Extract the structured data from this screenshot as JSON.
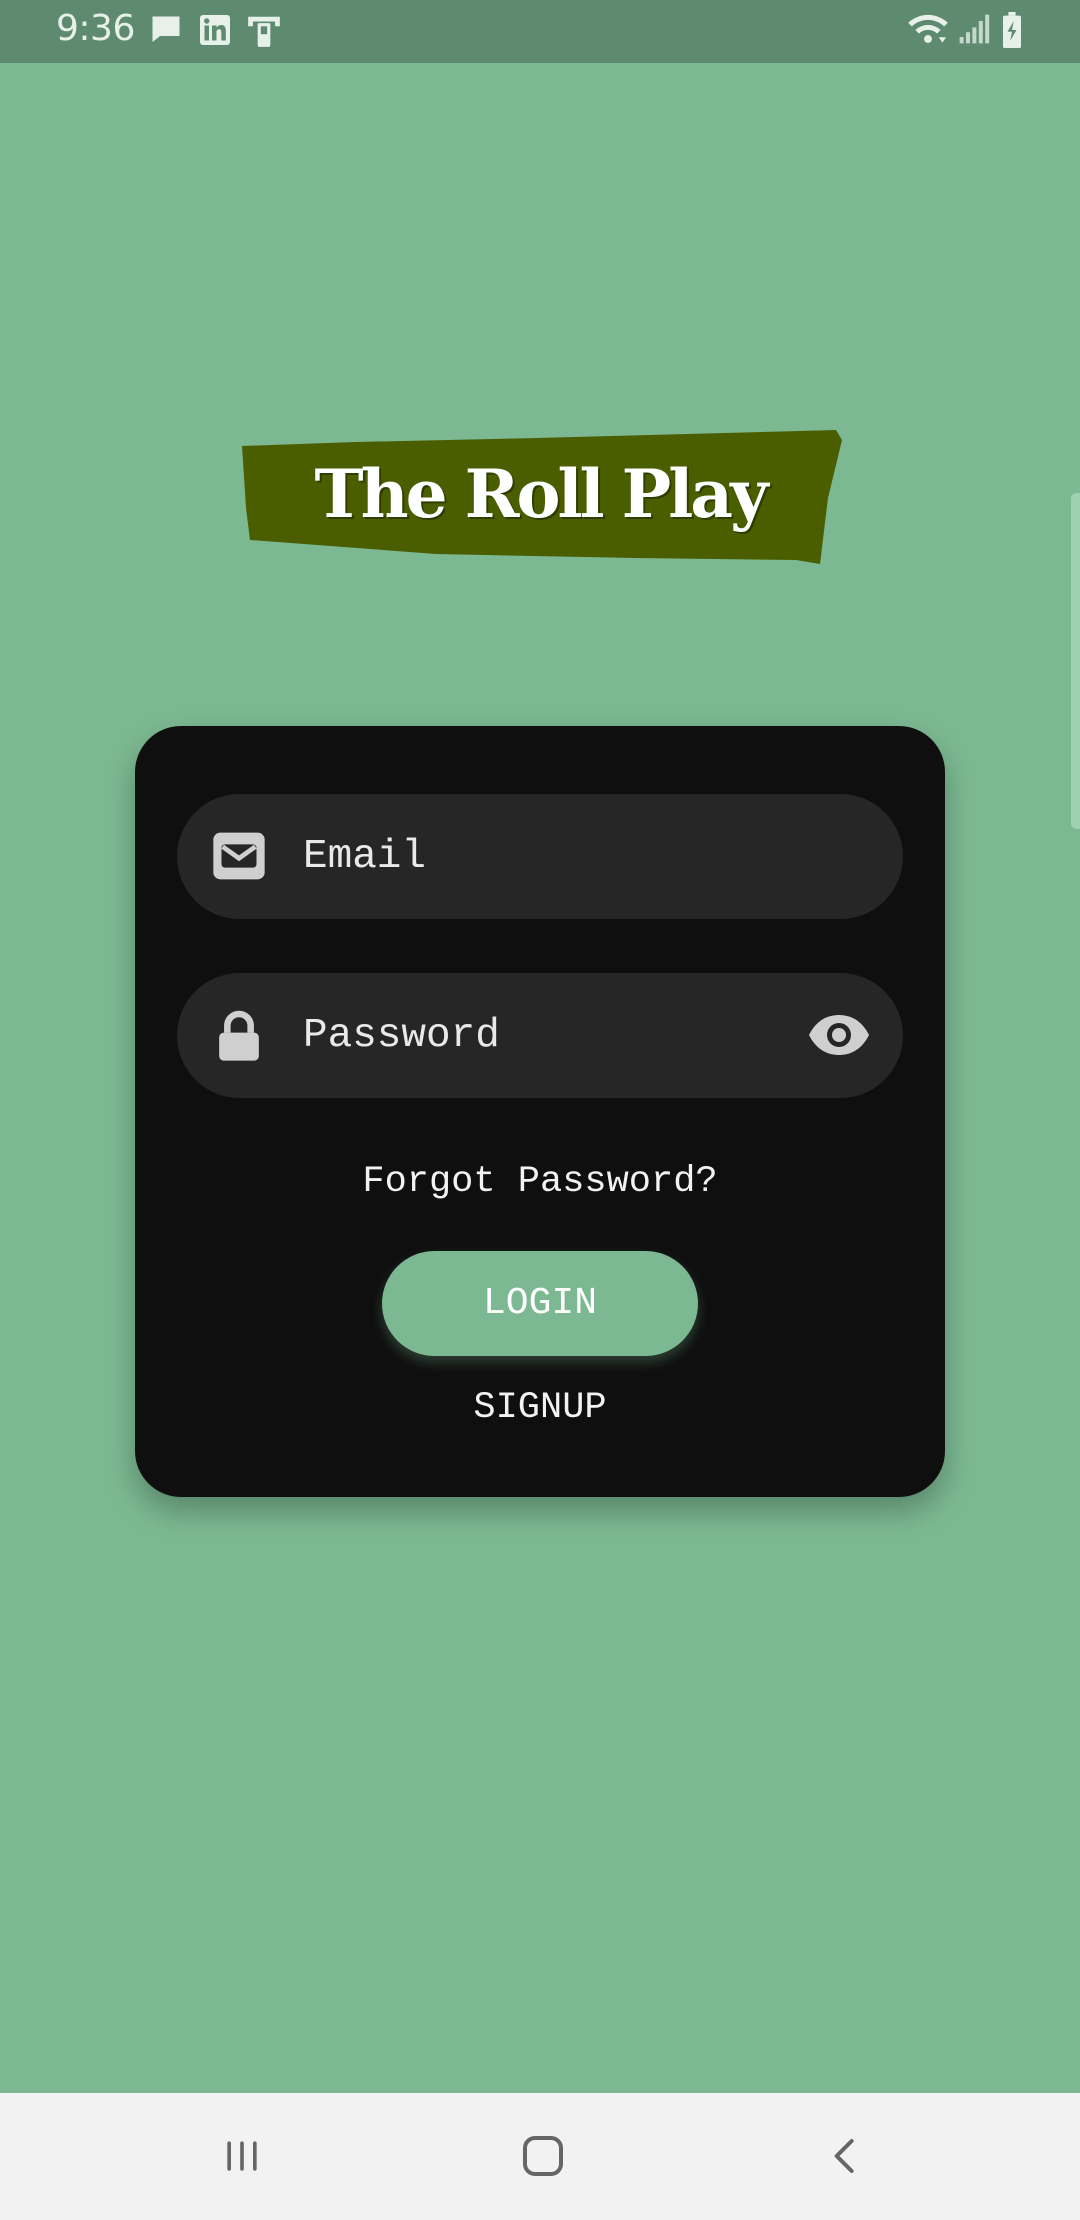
{
  "status_bar": {
    "time": "9:36",
    "notification_icons": [
      "message-icon",
      "linkedin-icon",
      "pocket-icon"
    ],
    "system_icons": [
      "wifi-icon",
      "signal-icon",
      "battery-charging-icon"
    ]
  },
  "logo": {
    "text": "The Roll Play",
    "background_color": "#4a5e00"
  },
  "login_form": {
    "email": {
      "placeholder": "Email",
      "value": "",
      "icon": "envelope-icon"
    },
    "password": {
      "placeholder": "Password",
      "value": "",
      "icon": "lock-icon",
      "toggle_icon": "eye-icon"
    },
    "forgot_password_label": "Forgot Password?",
    "login_label": "LOGIN",
    "signup_label": "SIGNUP"
  },
  "nav_bar": {
    "buttons": [
      "recent-apps-icon",
      "home-icon",
      "back-icon"
    ]
  },
  "colors": {
    "background": "#7cb992",
    "status_bar": "#5e8b70",
    "card": "#0f0f0f",
    "field": "#262626",
    "accent": "#7cb992"
  }
}
